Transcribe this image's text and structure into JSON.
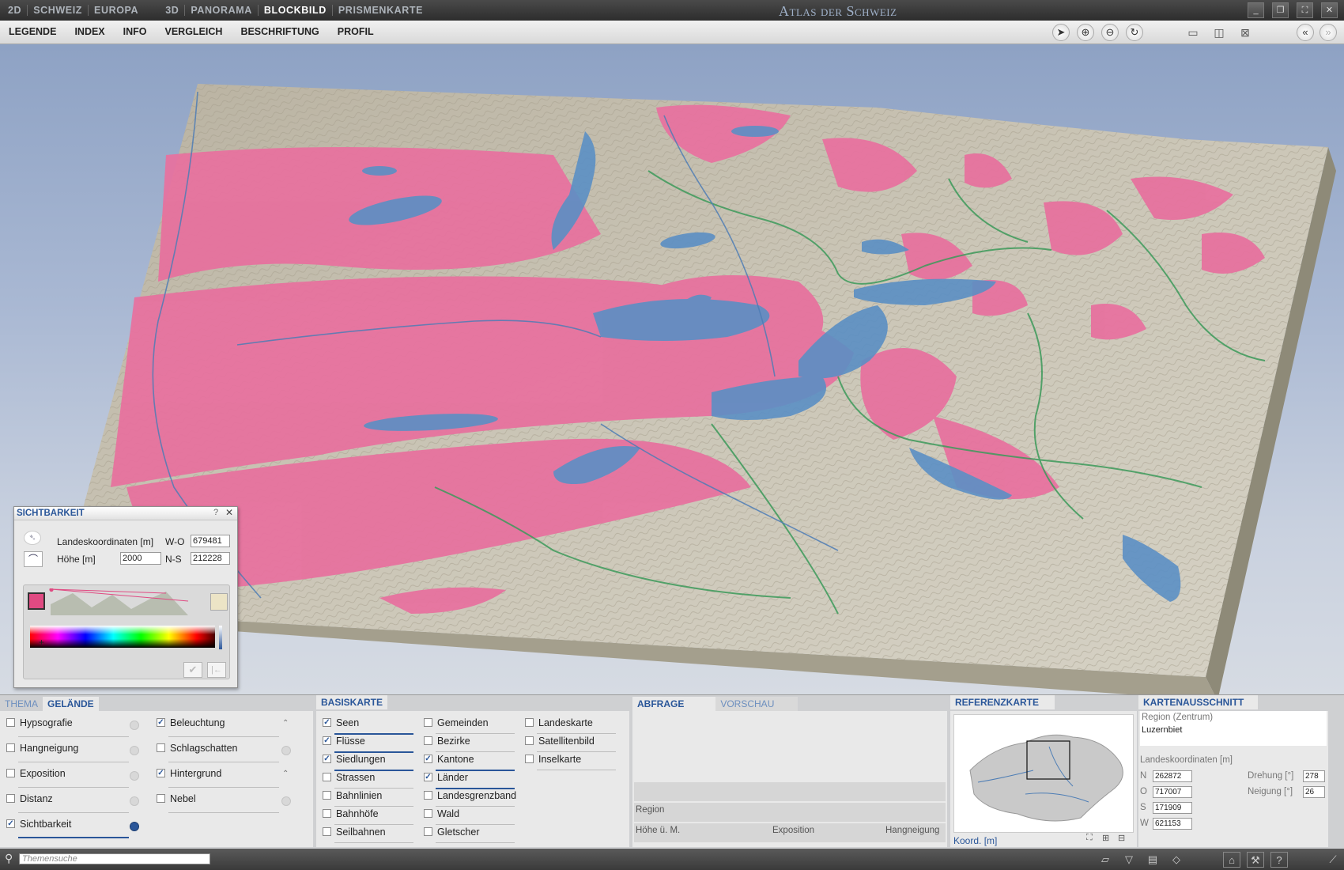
{
  "titlebar": {
    "modes": [
      "2D",
      "SCHWEIZ",
      "EUROPA",
      "3D",
      "PANORAMA",
      "BLOCKBILD",
      "PRISMENKARTE"
    ],
    "active_mode": "BLOCKBILD",
    "app_title": "Atlas der Schweiz"
  },
  "menubar": {
    "items": [
      "LEGENDE",
      "INDEX",
      "INFO",
      "VERGLEICH",
      "BESCHRIFTUNG",
      "PROFIL"
    ]
  },
  "icons": {
    "tools": [
      "pointer-icon",
      "zoom-in-icon",
      "zoom-out-icon",
      "rotate-icon"
    ],
    "views": [
      "split-horizontal-icon",
      "split-vertical-icon",
      "no-split-icon"
    ],
    "nav": [
      "collapse-left-icon",
      "expand-right-icon"
    ]
  },
  "colors": {
    "visibility": "#e8709e",
    "lake": "#5b8fc4",
    "terrain": "#c9c4b4",
    "accent": "#2a5699"
  },
  "sichtbarkeit": {
    "title": "SICHTBARKEIT",
    "help": "?",
    "coords_label": "Landeskoordinaten [m]",
    "wo_label": "W-O",
    "wo_value": "679481",
    "height_label": "Höhe [m]",
    "height_value": "2000",
    "ns_label": "N-S",
    "ns_value": "212228",
    "color_visible": "#e04a82",
    "color_hidden": "#ece4c6"
  },
  "thema_panel": {
    "tabs": [
      "THEMA",
      "GELÄNDE"
    ],
    "active_tab": "GELÄNDE",
    "col1": [
      {
        "label": "Hypsografie",
        "checked": false
      },
      {
        "label": "Hangneigung",
        "checked": false
      },
      {
        "label": "Exposition",
        "checked": false
      },
      {
        "label": "Distanz",
        "checked": false
      },
      {
        "label": "Sichtbarkeit",
        "checked": true
      }
    ],
    "col2": [
      {
        "label": "Beleuchtung",
        "checked": true
      },
      {
        "label": "Schlagschatten",
        "checked": false
      },
      {
        "label": "Hintergrund",
        "checked": true
      },
      {
        "label": "Nebel",
        "checked": false
      }
    ]
  },
  "basiskarte": {
    "title": "BASISKARTE",
    "col1": [
      {
        "label": "Seen",
        "checked": true
      },
      {
        "label": "Flüsse",
        "checked": true
      },
      {
        "label": "Siedlungen",
        "checked": true
      },
      {
        "label": "Strassen",
        "checked": false
      },
      {
        "label": "Bahnlinien",
        "checked": false
      },
      {
        "label": "Bahnhöfe",
        "checked": false
      },
      {
        "label": "Seilbahnen",
        "checked": false
      }
    ],
    "col2": [
      {
        "label": "Gemeinden",
        "checked": false
      },
      {
        "label": "Bezirke",
        "checked": false
      },
      {
        "label": "Kantone",
        "checked": true
      },
      {
        "label": "Länder",
        "checked": true
      },
      {
        "label": "Landesgrenzband",
        "checked": false
      },
      {
        "label": "Wald",
        "checked": false
      },
      {
        "label": "Gletscher",
        "checked": false
      }
    ],
    "col3": [
      {
        "label": "Landeskarte",
        "checked": false
      },
      {
        "label": "Satellitenbild",
        "checked": false
      },
      {
        "label": "Inselkarte",
        "checked": false
      }
    ]
  },
  "abfrage": {
    "tabs": [
      "ABFRAGE",
      "VORSCHAU"
    ],
    "region_label": "Region",
    "hoehe_label": "Höhe ü. M.",
    "exposition_label": "Exposition",
    "hangneigung_label": "Hangneigung"
  },
  "referenzkarte": {
    "title": "REFERENZKARTE",
    "koord_label": "Koord. [m]"
  },
  "kartenausschnitt": {
    "title": "KARTENAUSSCHNITT",
    "region_label": "Region (Zentrum)",
    "region_value": "Luzernbiet",
    "coords_label": "Landeskoordinaten [m]",
    "n_label": "N",
    "n_value": "262872",
    "o_label": "O",
    "o_value": "717007",
    "s_label": "S",
    "s_value": "171909",
    "w_label": "W",
    "w_value": "621153",
    "drehung_label": "Drehung [°]",
    "drehung_value": "278",
    "neigung_label": "Neigung [°]",
    "neigung_value": "26"
  },
  "statusbar": {
    "search_placeholder": "Themensuche"
  }
}
